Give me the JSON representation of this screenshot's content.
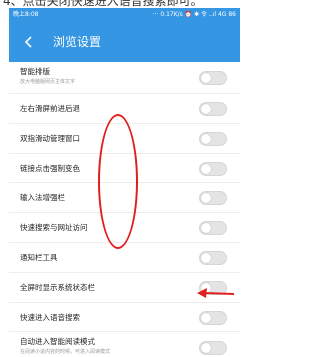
{
  "caption": "4、点击关闭快速进入语音搜索即可。",
  "status_bar": {
    "time": "晚上8:08",
    "right": "··· 0.17K/s ⏰ ✱ 令 ..ıl 4G 86"
  },
  "header": {
    "title": "浏览设置"
  },
  "settings": [
    {
      "label": "智能排版",
      "sublabel": "放大电脑版网页主体文字",
      "enabled": false
    },
    {
      "label": "左右滑屏前进后退",
      "enabled": false
    },
    {
      "label": "双指滑动管理窗口",
      "enabled": false
    },
    {
      "label": "链接点击强制变色",
      "enabled": false
    },
    {
      "label": "输入法增强栏",
      "enabled": false
    },
    {
      "label": "快速搜索与网址访问",
      "enabled": false
    },
    {
      "label": "通知栏工具",
      "enabled": false
    },
    {
      "label": "全屏时显示系统状态栏",
      "enabled": false
    },
    {
      "label": "快速进入语音搜索",
      "enabled": false
    },
    {
      "label": "自动进入智能阅读模式",
      "sublabel": "在阅读小说内容的时候，可进入阅读模式",
      "enabled": false
    }
  ],
  "colors": {
    "accent": "#3596e4",
    "annotation": "#e02020"
  }
}
